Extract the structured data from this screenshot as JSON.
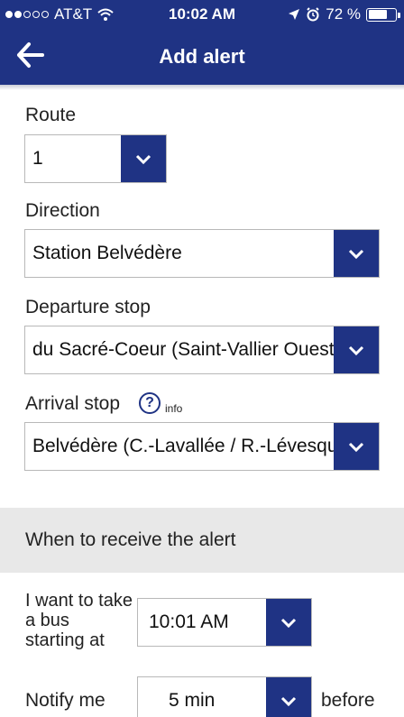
{
  "status_bar": {
    "carrier": "AT&T",
    "time": "10:02 AM",
    "battery_percent": "72 %",
    "battery_level": 0.72
  },
  "header": {
    "title": "Add alert",
    "back_icon": "arrow-left-icon"
  },
  "form": {
    "route": {
      "label": "Route",
      "value": "1"
    },
    "direction": {
      "label": "Direction",
      "value": "Station Belvédère"
    },
    "departure_stop": {
      "label": "Departure stop",
      "value": "du Sacré-Coeur (Saint-Vallier Ouest)"
    },
    "arrival_stop": {
      "label": "Arrival stop",
      "info_label": "info",
      "value": "Belvédère (C.-Lavallée / R.-Lévesque)"
    }
  },
  "alert_section": {
    "title": "When to receive the alert",
    "start_label": "I want to take a bus starting at",
    "start_time": "10:01 AM",
    "notify_label": "Notify me",
    "notify_value": "5 min",
    "notify_suffix": "before"
  },
  "colors": {
    "primary": "#1f3384",
    "section_background": "#e8e8e8",
    "border": "#b8b8b8"
  }
}
